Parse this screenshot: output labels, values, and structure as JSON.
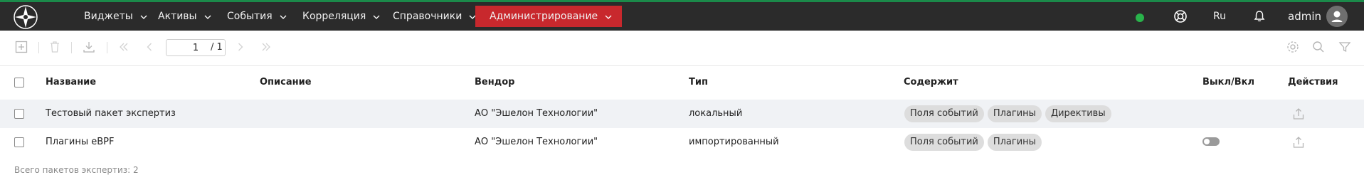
{
  "navbar": {
    "items": [
      {
        "label": "Виджеты"
      },
      {
        "label": "Активы"
      },
      {
        "label": "События"
      },
      {
        "label": "Корреляция"
      },
      {
        "label": "Справочники"
      },
      {
        "label": "Администрирование",
        "active": true
      }
    ],
    "language": "Ru",
    "user": "admin",
    "colors": {
      "background": "#2b2b2b",
      "active": "#c8282d",
      "status": "#29b34b"
    },
    "icons": [
      "app-logo-icon",
      "status-online-icon",
      "help-lifebuoy-icon",
      "notifications-bell-icon",
      "user-avatar-icon"
    ]
  },
  "toolbar": {
    "page_value": "1",
    "page_total": "/ 1",
    "icons": [
      "add-icon",
      "delete-icon",
      "download-icon",
      "first-page-icon",
      "prev-page-icon",
      "next-page-icon",
      "last-page-icon",
      "settings-icon",
      "search-icon",
      "filter-icon"
    ]
  },
  "table": {
    "columns": [
      "Название",
      "Описание",
      "Вендор",
      "Тип",
      "Содержит",
      "Выкл/Вкл",
      "Действия"
    ],
    "rows": [
      {
        "name": "Тестовый пакет экспертиз",
        "description": "",
        "vendor": "АО \"Эшелон Технологии\"",
        "type": "локальный",
        "contains": [
          "Поля событий",
          "Плагины",
          "Директивы"
        ],
        "enabled_toggle_visible": false
      },
      {
        "name": "Плагины eBPF",
        "description": "",
        "vendor": "АО \"Эшелон Технологии\"",
        "type": "импортированный",
        "contains": [
          "Поля событий",
          "Плагины"
        ],
        "enabled_toggle_visible": true,
        "enabled": false
      }
    ]
  },
  "footer": {
    "total_text": "Всего пакетов экспертиз: 2"
  }
}
